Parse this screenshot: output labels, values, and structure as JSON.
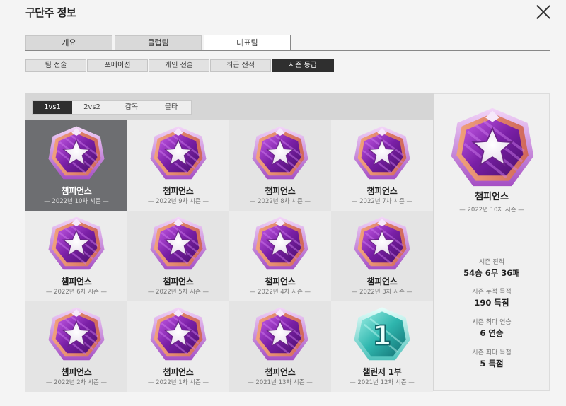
{
  "window": {
    "title": "구단주 정보"
  },
  "main_tabs": [
    {
      "label": "개요",
      "active": false
    },
    {
      "label": "클럽팀",
      "active": false
    },
    {
      "label": "대표팀",
      "active": true
    }
  ],
  "sub_tabs": [
    {
      "label": "팀 전술",
      "active": false
    },
    {
      "label": "포메이션",
      "active": false
    },
    {
      "label": "개인 전술",
      "active": false
    },
    {
      "label": "최근 전적",
      "active": false
    },
    {
      "label": "시즌 등급",
      "active": true
    }
  ],
  "mode_tabs": [
    {
      "label": "1vs1",
      "active": true
    },
    {
      "label": "2vs2",
      "active": false
    },
    {
      "label": "감독",
      "active": false
    },
    {
      "label": "볼타",
      "active": false
    }
  ],
  "seasons": [
    {
      "grade": "챔피언스",
      "season": "2022년 10차 시즌",
      "icon": "champions-badge-icon",
      "selected": true
    },
    {
      "grade": "챔피언스",
      "season": "2022년 9차 시즌",
      "icon": "champions-badge-icon"
    },
    {
      "grade": "챔피언스",
      "season": "2022년 8차 시즌",
      "icon": "champions-badge-icon"
    },
    {
      "grade": "챔피언스",
      "season": "2022년 7차 시즌",
      "icon": "champions-badge-icon"
    },
    {
      "grade": "챔피언스",
      "season": "2022년 6차 시즌",
      "icon": "champions-badge-icon"
    },
    {
      "grade": "챔피언스",
      "season": "2022년 5차 시즌",
      "icon": "champions-badge-icon"
    },
    {
      "grade": "챔피언스",
      "season": "2022년 4차 시즌",
      "icon": "champions-badge-icon"
    },
    {
      "grade": "챔피언스",
      "season": "2022년 3차 시즌",
      "icon": "champions-badge-icon"
    },
    {
      "grade": "챔피언스",
      "season": "2022년 2차 시즌",
      "icon": "champions-badge-icon"
    },
    {
      "grade": "챔피언스",
      "season": "2022년 1차 시즌",
      "icon": "champions-badge-icon"
    },
    {
      "grade": "챔피언스",
      "season": "2021년 13차 시즌",
      "icon": "champions-badge-icon"
    },
    {
      "grade": "챌린저 1부",
      "season": "2021년 12차 시즌",
      "icon": "challenger-1-badge-icon"
    }
  ],
  "detail": {
    "grade": "챔피언스",
    "season": "2022년 10차 시즌",
    "stats": [
      {
        "label": "시즌 전적",
        "value": "54승 6무 36패"
      },
      {
        "label": "시즌 누적 득점",
        "value": "190 득점"
      },
      {
        "label": "시즌 최다 연승",
        "value": "6 연승"
      },
      {
        "label": "시즌 최다 득점",
        "value": "5 득점"
      }
    ]
  },
  "colors": {
    "champions_purple": "#8e2bb3",
    "champions_orange": "#e58a6f",
    "challenger_teal": "#35b9b3",
    "selected_cell": "#6d6e71",
    "active_tab": "#2f2f2f"
  }
}
